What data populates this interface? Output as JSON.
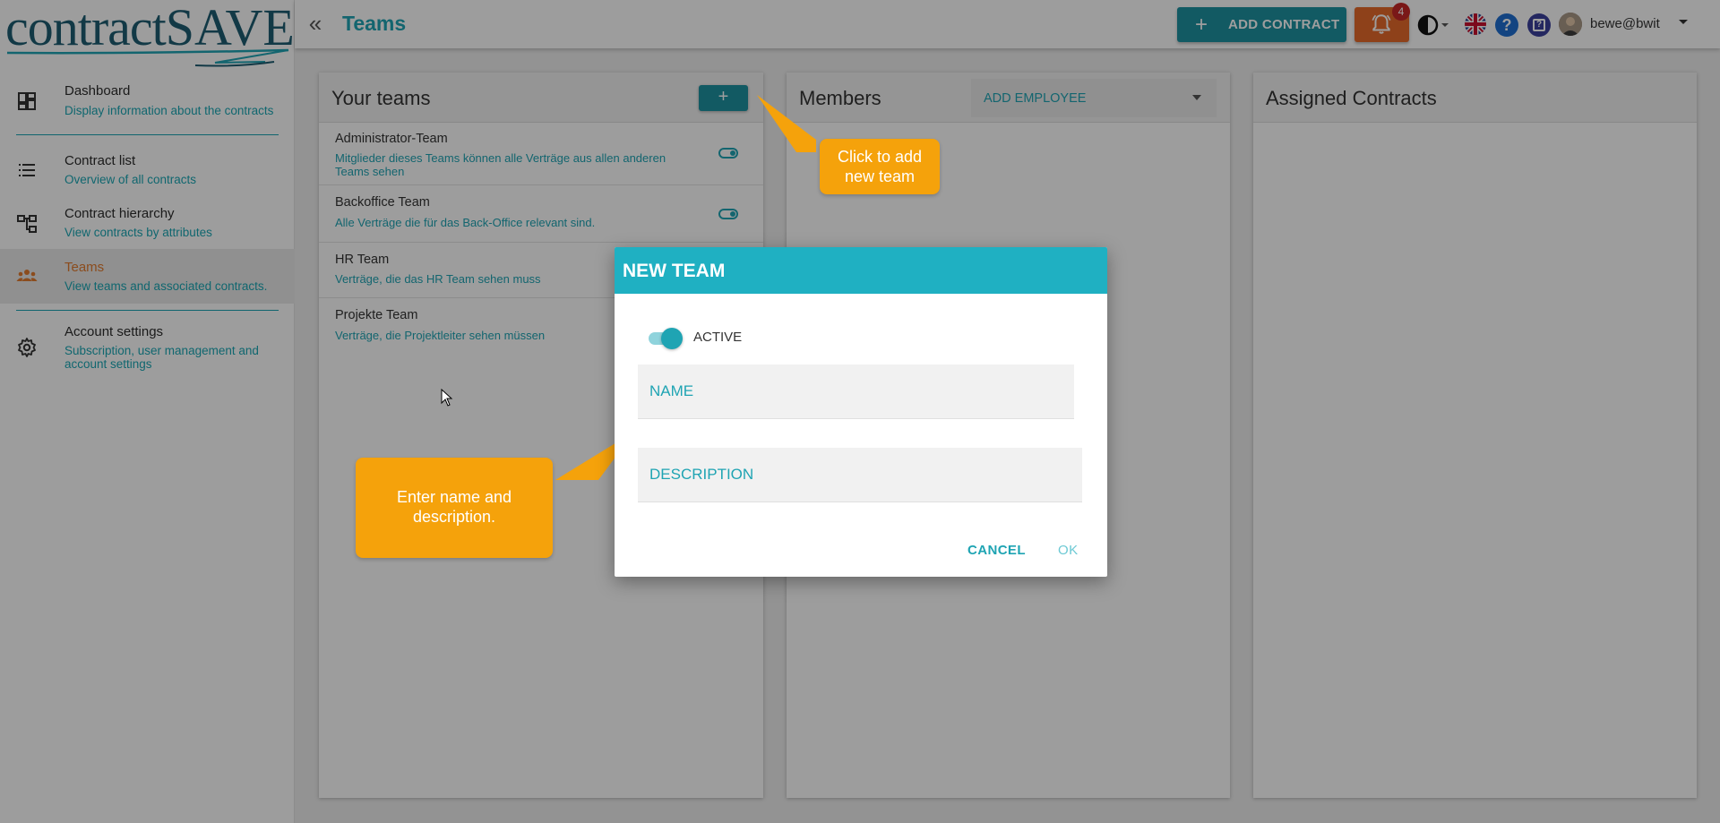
{
  "logo": {
    "prefix": "contract",
    "suffix": "SAVE"
  },
  "nav": [
    {
      "title": "Dashboard",
      "subtitle": "Display information about the contracts",
      "icon": "dashboard-icon"
    },
    {
      "title": "Contract list",
      "subtitle": "Overview of all contracts",
      "icon": "list-icon"
    },
    {
      "title": "Contract hierarchy",
      "subtitle": "View contracts by attributes",
      "icon": "hierarchy-icon"
    },
    {
      "title": "Teams",
      "subtitle": "View teams and associated contracts.",
      "icon": "teams-icon",
      "active": true
    },
    {
      "title": "Account settings",
      "subtitle": "Subscription, user management and account settings",
      "icon": "gear-icon"
    }
  ],
  "topbar": {
    "page_title": "Teams",
    "add_contract_label": "ADD CONTRACT",
    "notification_count": "4",
    "user_name": "bewe@bwit"
  },
  "panels": {
    "teams_title": "Your teams",
    "add_team_label": "+",
    "members_title": "Members",
    "add_employee_label": "ADD EMPLOYEE",
    "contracts_title": "Assigned Contracts"
  },
  "teams": [
    {
      "name": "Administrator-Team",
      "description": "Mitglieder dieses Teams können alle Verträge aus allen anderen Teams sehen"
    },
    {
      "name": "Backoffice Team",
      "description": "Alle Verträge die für das Back-Office relevant sind."
    },
    {
      "name": "HR Team",
      "description": "Verträge, die das HR Team sehen muss"
    },
    {
      "name": "Projekte Team",
      "description": "Verträge, die Projektleiter sehen müssen"
    }
  ],
  "dialog": {
    "title": "NEW TEAM",
    "active_label": "ACTIVE",
    "name_placeholder": "NAME",
    "description_placeholder": "DESCRIPTION",
    "cancel_label": "CANCEL",
    "ok_label": "OK"
  },
  "callouts": {
    "add_team": "Click to add new team",
    "enter_name": "Enter name and description."
  },
  "colors": {
    "accent": "#1fa4b3",
    "button": "#1d91a0",
    "notification": "#e56a2a",
    "callout": "#f5a20b",
    "active_nav": "#e07b2f"
  }
}
